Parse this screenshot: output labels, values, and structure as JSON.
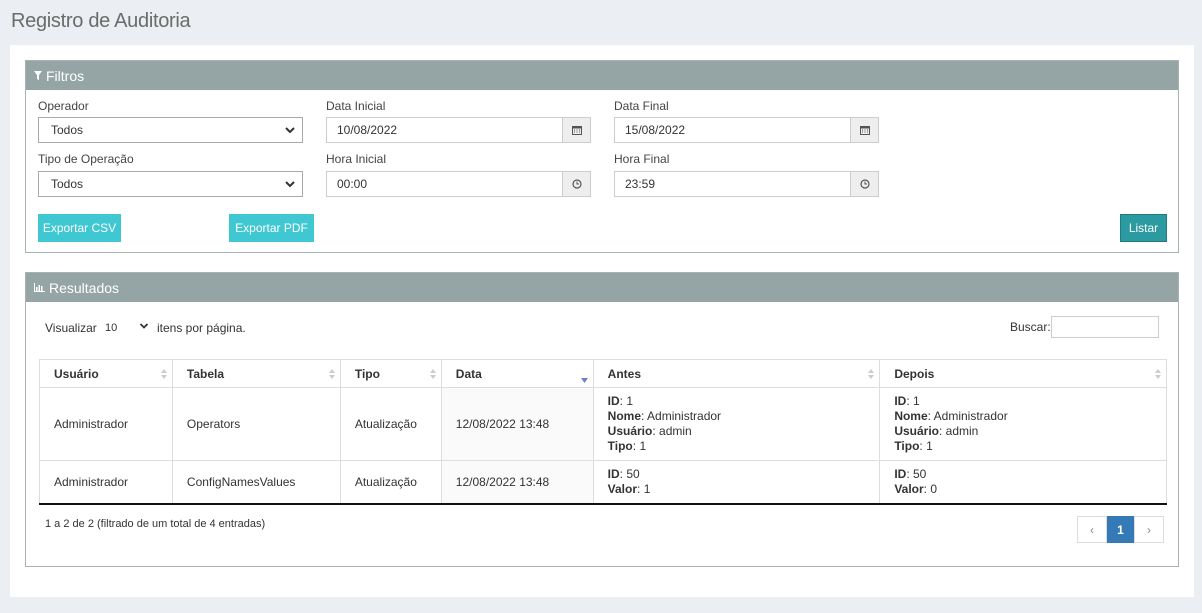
{
  "page": {
    "title": "Registro de Auditoria"
  },
  "filters": {
    "heading": "Filtros",
    "operador": {
      "label": "Operador",
      "value": "Todos"
    },
    "tipo_operacao": {
      "label": "Tipo de Operação",
      "value": "Todos"
    },
    "data_inicial": {
      "label": "Data Inicial",
      "value": "10/08/2022"
    },
    "data_final": {
      "label": "Data Final",
      "value": "15/08/2022"
    },
    "hora_inicial": {
      "label": "Hora Inicial",
      "value": "00:00"
    },
    "hora_final": {
      "label": "Hora Final",
      "value": "23:59"
    },
    "export_csv": "Exportar CSV",
    "export_pdf": "Exportar PDF",
    "listar": "Listar"
  },
  "results": {
    "heading": "Resultados",
    "show_prefix": "Visualizar",
    "page_length": "10",
    "show_suffix": "itens por página.",
    "search_label": "Buscar:",
    "search_value": "",
    "columns": [
      "Usuário",
      "Tabela",
      "Tipo",
      "Data",
      "Antes",
      "Depois"
    ],
    "rows": [
      {
        "usuario": "Administrador",
        "tabela": "Operators",
        "tipo": "Atualização",
        "data": "12/08/2022 13:48",
        "antes": {
          "id": "1",
          "nome": "Administrador",
          "usuario": "admin",
          "tipo": "1"
        },
        "depois": {
          "id": "1",
          "nome": "Administrador",
          "usuario": "admin",
          "tipo": "1"
        }
      },
      {
        "usuario": "Administrador",
        "tabela": "ConfigNamesValues",
        "tipo": "Atualização",
        "data": "12/08/2022 13:48",
        "antes": {
          "id": "50",
          "valor": "1"
        },
        "depois": {
          "id": "50",
          "valor": "0"
        }
      }
    ],
    "kv_labels": {
      "id": "ID",
      "nome": "Nome",
      "usuario": "Usuário",
      "tipo": "Tipo",
      "valor": "Valor"
    },
    "info": "1 a 2 de 2 (filtrado de um total de 4 entradas)",
    "pagination": {
      "prev": "‹",
      "current": "1",
      "next": "›"
    }
  },
  "colors": {
    "panel_header": "#95a5a6",
    "button_teal": "#3fc8d2",
    "button_listar": "#2b9aa1",
    "page_active": "#337ab7"
  }
}
